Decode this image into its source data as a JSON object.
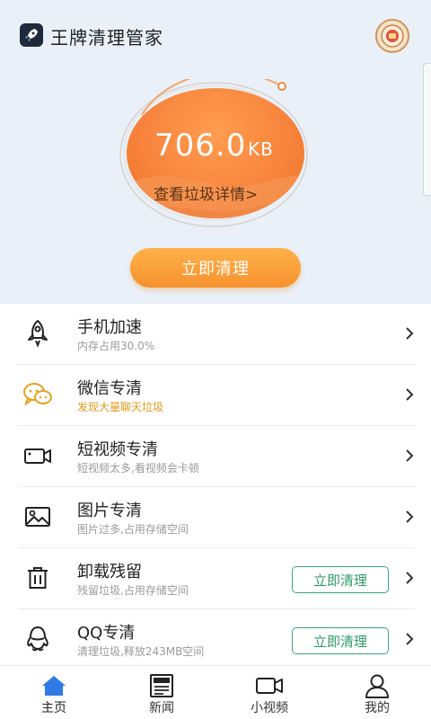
{
  "header": {
    "app_title": "王牌清理管家",
    "logo_icon": "rocket-icon",
    "badge_icon": "red-packet-badge-icon"
  },
  "junk": {
    "size_value": "706.0",
    "size_unit": "KB",
    "detail_link": "查看垃圾详情>",
    "clean_button": "立即清理"
  },
  "features": [
    {
      "title": "手机加速",
      "subtitle": "内存占用30.0%",
      "icon": "rocket-outline-icon",
      "subtitle_color": "#9a9a9a"
    },
    {
      "title": "微信专清",
      "subtitle": "发现大量聊天垃圾",
      "icon": "wechat-icon",
      "subtitle_color": "#e09a1c"
    },
    {
      "title": "短视频专清",
      "subtitle": "短视频太多,看视频会卡顿",
      "icon": "video-camera-icon"
    },
    {
      "title": "图片专清",
      "subtitle": "图片过多,占用存储空间",
      "icon": "image-icon"
    },
    {
      "title": "卸载残留",
      "subtitle": "残留垃圾,占用存储空间",
      "icon": "trash-icon",
      "action": "立即清理"
    },
    {
      "title": "QQ专清",
      "subtitle": "清理垃圾,释放243MB空间",
      "icon": "qq-penguin-icon",
      "action": "立即清理"
    }
  ],
  "nav": {
    "items": [
      {
        "label": "主页",
        "icon": "home-icon",
        "active": true
      },
      {
        "label": "新闻",
        "icon": "news-icon"
      },
      {
        "label": "小视频",
        "icon": "video-icon"
      },
      {
        "label": "我的",
        "icon": "user-icon"
      }
    ]
  },
  "colors": {
    "accent_orange": "#f7823b",
    "action_green": "#3aa878",
    "nav_active": "#2f7ae5",
    "top_bg": "#e9f0f8"
  }
}
